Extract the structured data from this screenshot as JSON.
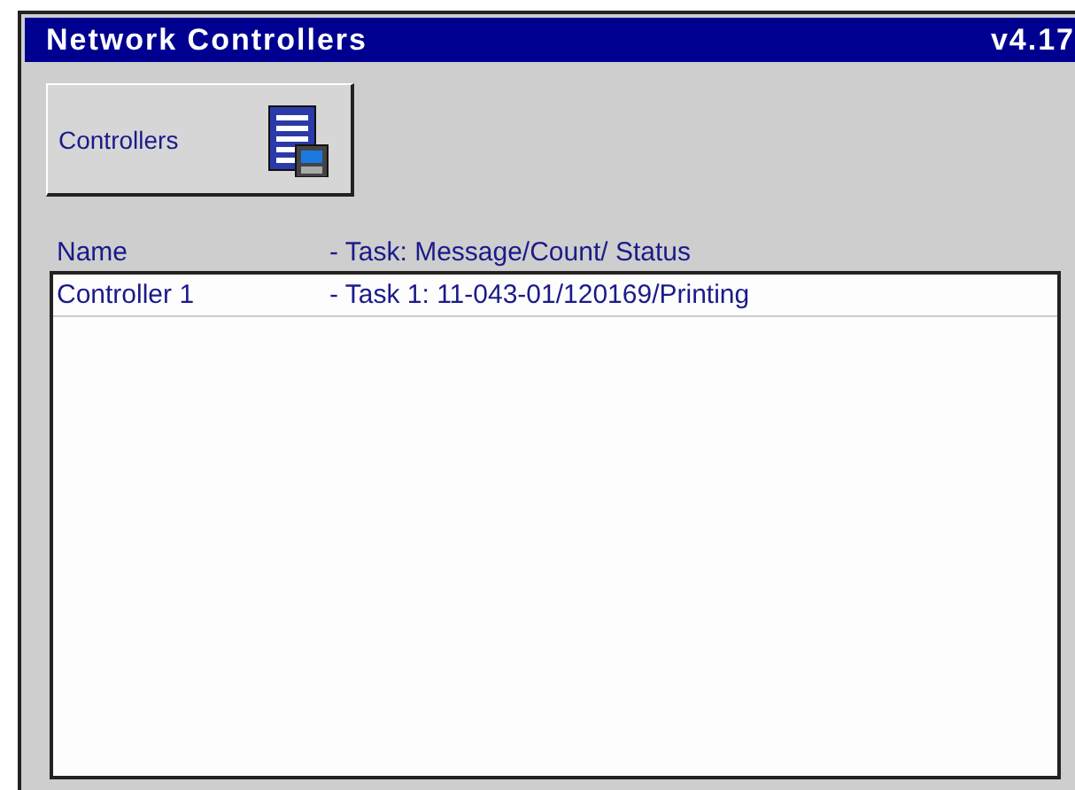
{
  "window": {
    "title": "Network Controllers",
    "version": "v4.17"
  },
  "toolbar": {
    "button": "Controllers"
  },
  "list": {
    "columns": [
      "Name",
      "- Task: Message/Count/ Status"
    ],
    "rows": [
      {
        "name": "Controller 1",
        "task": "- Task 1: 11-043-01/120169/Printing"
      }
    ]
  }
}
